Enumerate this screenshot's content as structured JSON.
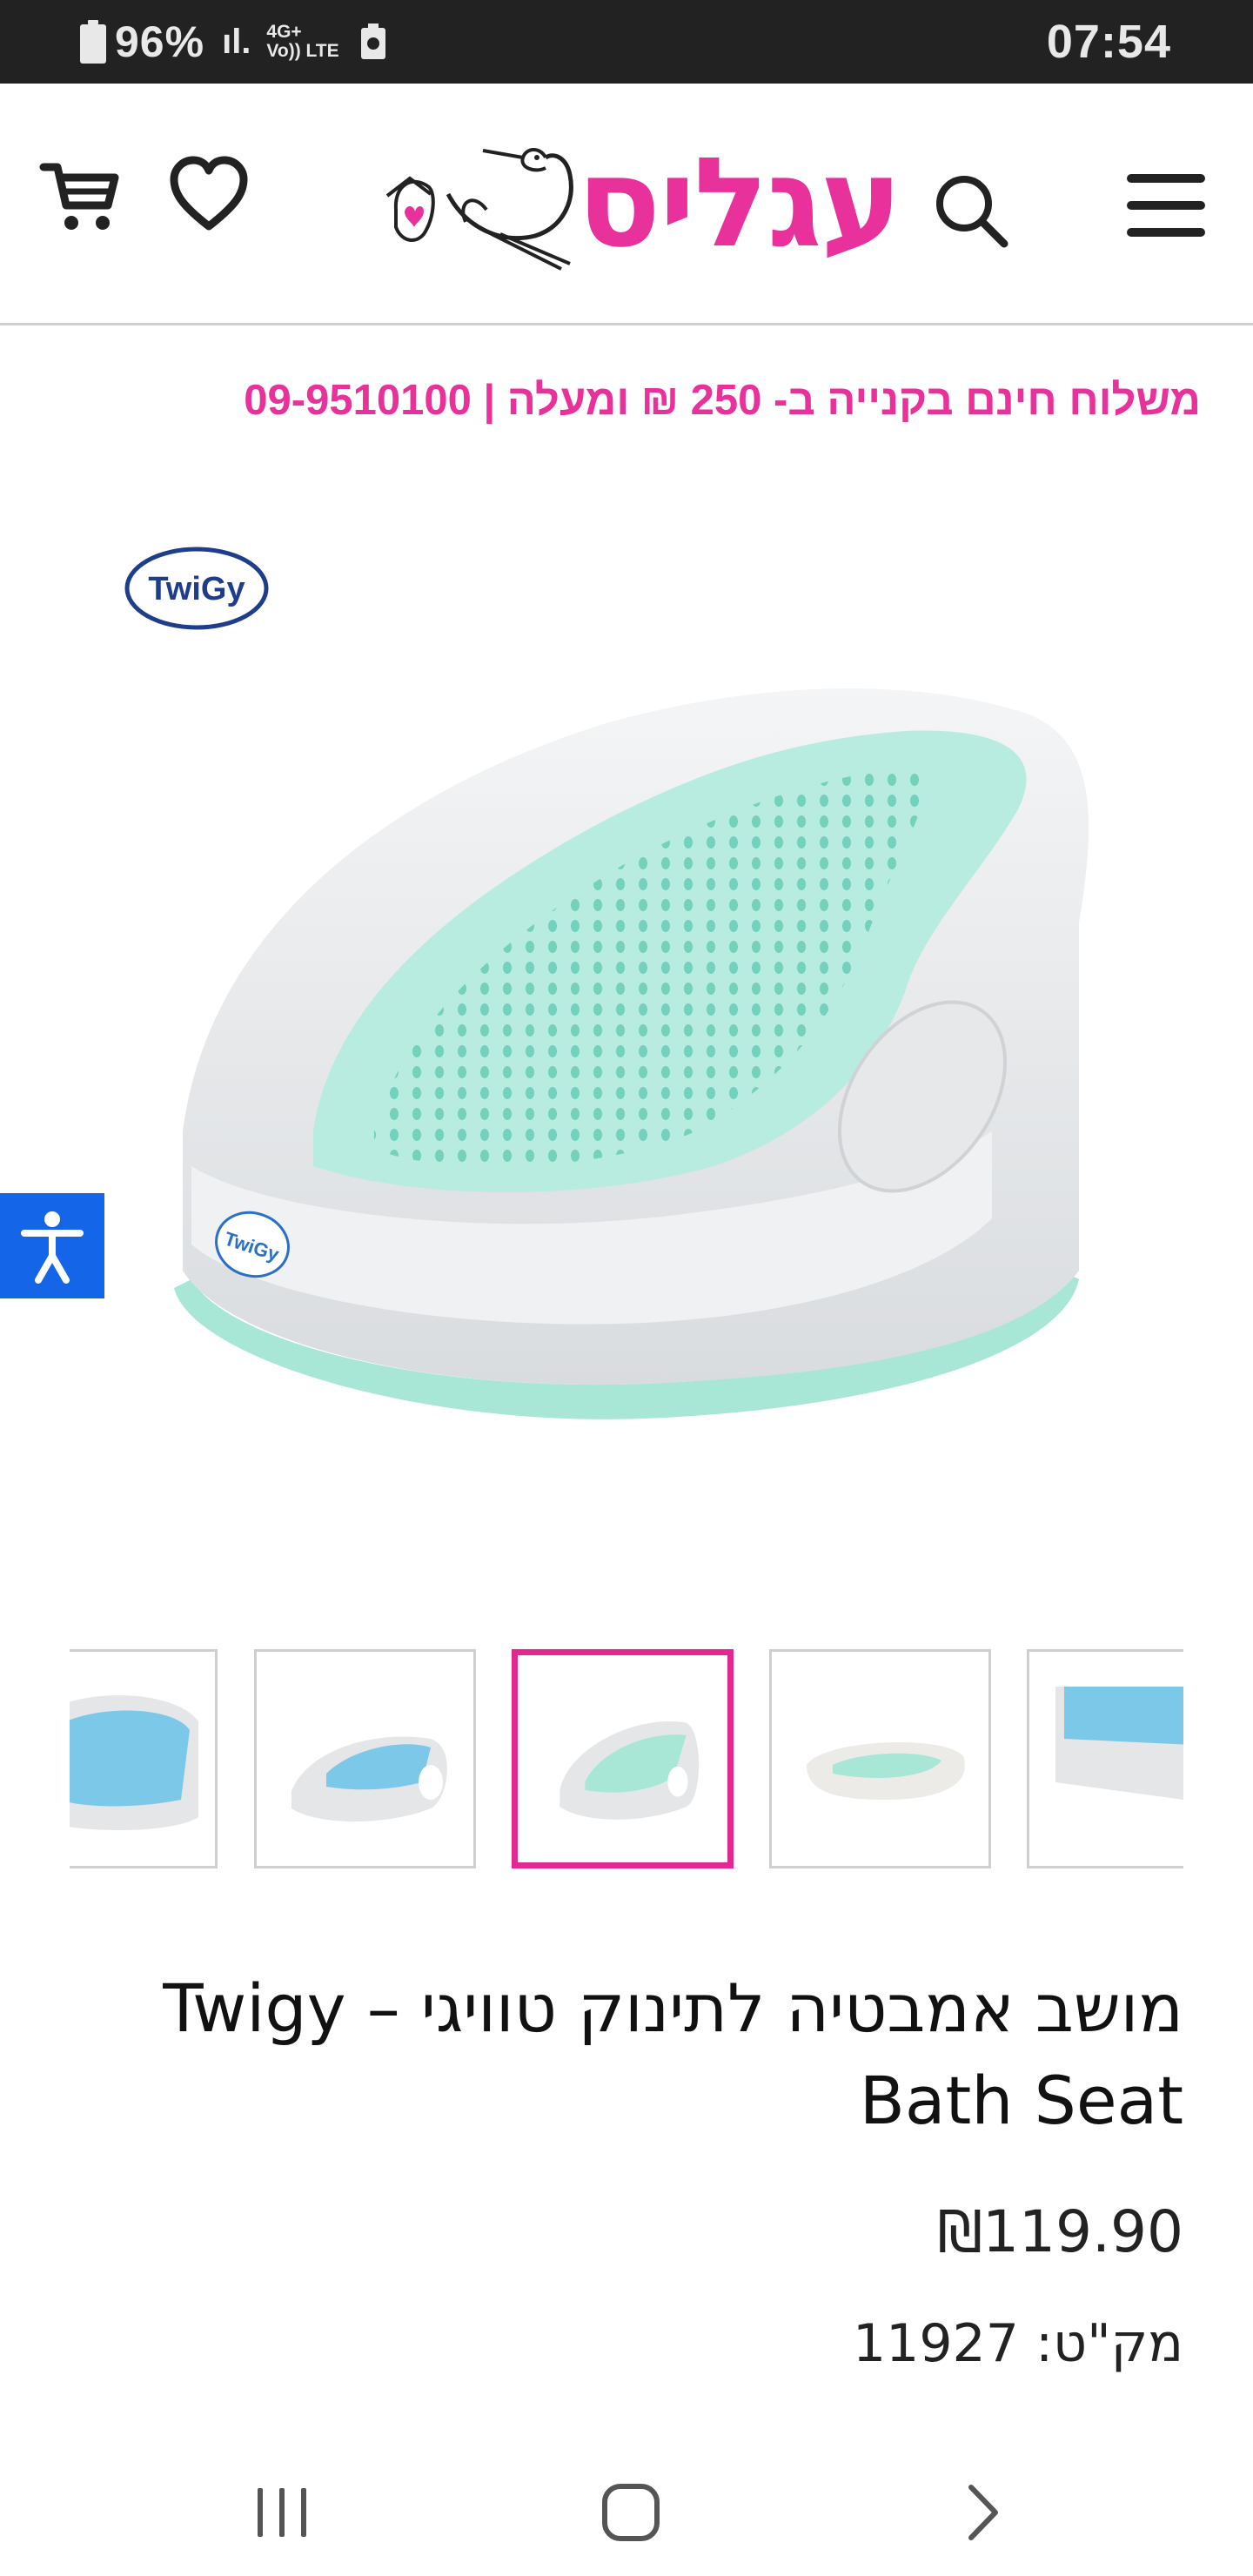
{
  "status_bar": {
    "battery": "96%",
    "signal": "ıl.",
    "network_top": "4G+",
    "network_sub": "Vo)) LTE",
    "time": "07:54"
  },
  "header": {
    "logo_text": "עגליס",
    "cart_icon": "cart-icon",
    "wishlist_icon": "heart-icon",
    "search_icon": "search-icon",
    "menu_icon": "hamburger-menu-icon"
  },
  "promo": {
    "text": "משלוח חינם בקנייה ב- 250 ₪ ומעלה | 09-9510100"
  },
  "brand": {
    "badge": "TwiGy"
  },
  "product": {
    "title": "מושב אמבטיה לתינוק טוויגי – Twigy Bath Seat",
    "price": "₪119.90",
    "sku": "מק\"ט: 11927"
  },
  "thumbnails": {
    "count": 5,
    "active_index": 2
  },
  "colors": {
    "brand_pink": "#e8319b",
    "accessibility_blue": "#1565e8",
    "seat_mint": "#a8e6d6",
    "seat_blue": "#7cc8e8"
  }
}
